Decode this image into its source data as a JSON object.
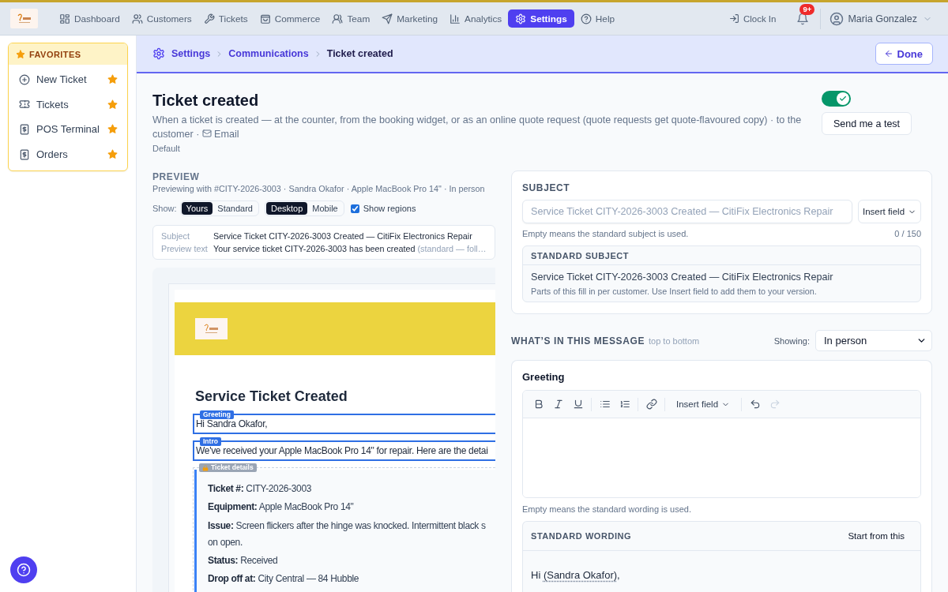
{
  "top_nav": {
    "items": [
      {
        "label": "Dashboard",
        "selected": false
      },
      {
        "label": "Customers",
        "selected": false
      },
      {
        "label": "Tickets",
        "selected": false
      },
      {
        "label": "Commerce",
        "selected": false
      },
      {
        "label": "Team",
        "selected": false
      },
      {
        "label": "Marketing",
        "selected": false
      },
      {
        "label": "Analytics",
        "selected": false
      },
      {
        "label": "Settings",
        "selected": true
      },
      {
        "label": "Help",
        "selected": false
      }
    ],
    "clock_in": "Clock In",
    "notifications_badge": "9+",
    "user_name": "Maria Gonzalez"
  },
  "sidebar": {
    "favorites": {
      "title": "FAVORITES",
      "items": [
        {
          "label": "New Ticket",
          "starred": true
        },
        {
          "label": "Tickets",
          "starred": true
        },
        {
          "label": "POS Terminal",
          "starred": true
        },
        {
          "label": "Orders",
          "starred": true
        }
      ]
    }
  },
  "breadcrumb": [
    {
      "label": "Settings",
      "current": false
    },
    {
      "label": "Communications",
      "current": false
    },
    {
      "label": "Ticket created",
      "current": true
    }
  ],
  "done_button": "Done",
  "header": {
    "title": "Ticket created",
    "description": "When a ticket is created — at the counter, from the booking widget, or as an online quote request (quote requests get quote-flavoured copy) · to the customer ·",
    "channel": "Email",
    "tag": "Default",
    "enabled": true,
    "test_button": "Send me a test"
  },
  "preview": {
    "heading": "PREVIEW",
    "context": "Previewing with #CITY-2026-3003 · Sandra Okafor · Apple MacBook Pro 14\" · In person",
    "show_label": "Show:",
    "version_options": [
      {
        "label": "Yours",
        "selected": true
      },
      {
        "label": "Standard",
        "selected": false
      }
    ],
    "device_options": [
      {
        "label": "Desktop",
        "selected": true
      },
      {
        "label": "Mobile",
        "selected": false
      }
    ],
    "show_regions": {
      "label": "Show regions",
      "checked": true
    },
    "meta": [
      {
        "label": "Subject",
        "value": "Service Ticket CITY-2026-3003 Created — CitiFix Electronics Repair"
      },
      {
        "label": "Preview text",
        "value": "Your service ticket CITY-2026-3003 has been created",
        "note": "(standard — foll…"
      }
    ],
    "email": {
      "heading": "Service Ticket Created",
      "regions": [
        {
          "kind": "editable",
          "label": "Greeting",
          "text": "Hi Sandra Okafor,"
        },
        {
          "kind": "editable",
          "label": "Intro",
          "text": "We've received your Apple MacBook Pro 14\" for repair. Here are the detai"
        },
        {
          "kind": "locked",
          "label": "Ticket details",
          "rows": [
            {
              "text": "**Ticket #:** CITY-2026-3003"
            },
            {
              "text": "**Equipment:** Apple MacBook Pro 14\""
            },
            {
              "text": "**Issue:** Screen flickers after the hinge was knocked. Intermittent black s",
              "text_continued": "on open."
            },
            {
              "text": "**Status:** Received"
            },
            {
              "text": "**Drop off at:** City Central — 84 Hubble"
            }
          ]
        }
      ]
    }
  },
  "subject": {
    "heading": "SUBJECT",
    "placeholder": "Service Ticket CITY-2026-3003 Created — CitiFix Electronics Repair",
    "insert_button": "Insert field",
    "helper": "Empty means the standard subject is used.",
    "counter": "0 / 150",
    "standard": {
      "heading": "STANDARD SUBJECT",
      "text": "Service Ticket CITY-2026-3003 Created — CitiFix Electronics Repair",
      "hint": "Parts of this fill in per customer. Use Insert field to add them to your version."
    }
  },
  "message": {
    "heading": "WHAT’S IN THIS MESSAGE",
    "subheading": "top to bottom",
    "showing_label": "Showing:",
    "showing_value": "In person",
    "section": {
      "title": "Greeting",
      "insert_button": "Insert field",
      "undo_disabled": false,
      "redo_disabled": true,
      "helper": "Empty means the standard wording is used.",
      "standard": {
        "heading": "STANDARD WORDING",
        "action": "Start from this",
        "greeting_prefix": "Hi ",
        "greeting_field": "(Sandra Okafor)",
        "greeting_suffix": ","
      }
    }
  }
}
